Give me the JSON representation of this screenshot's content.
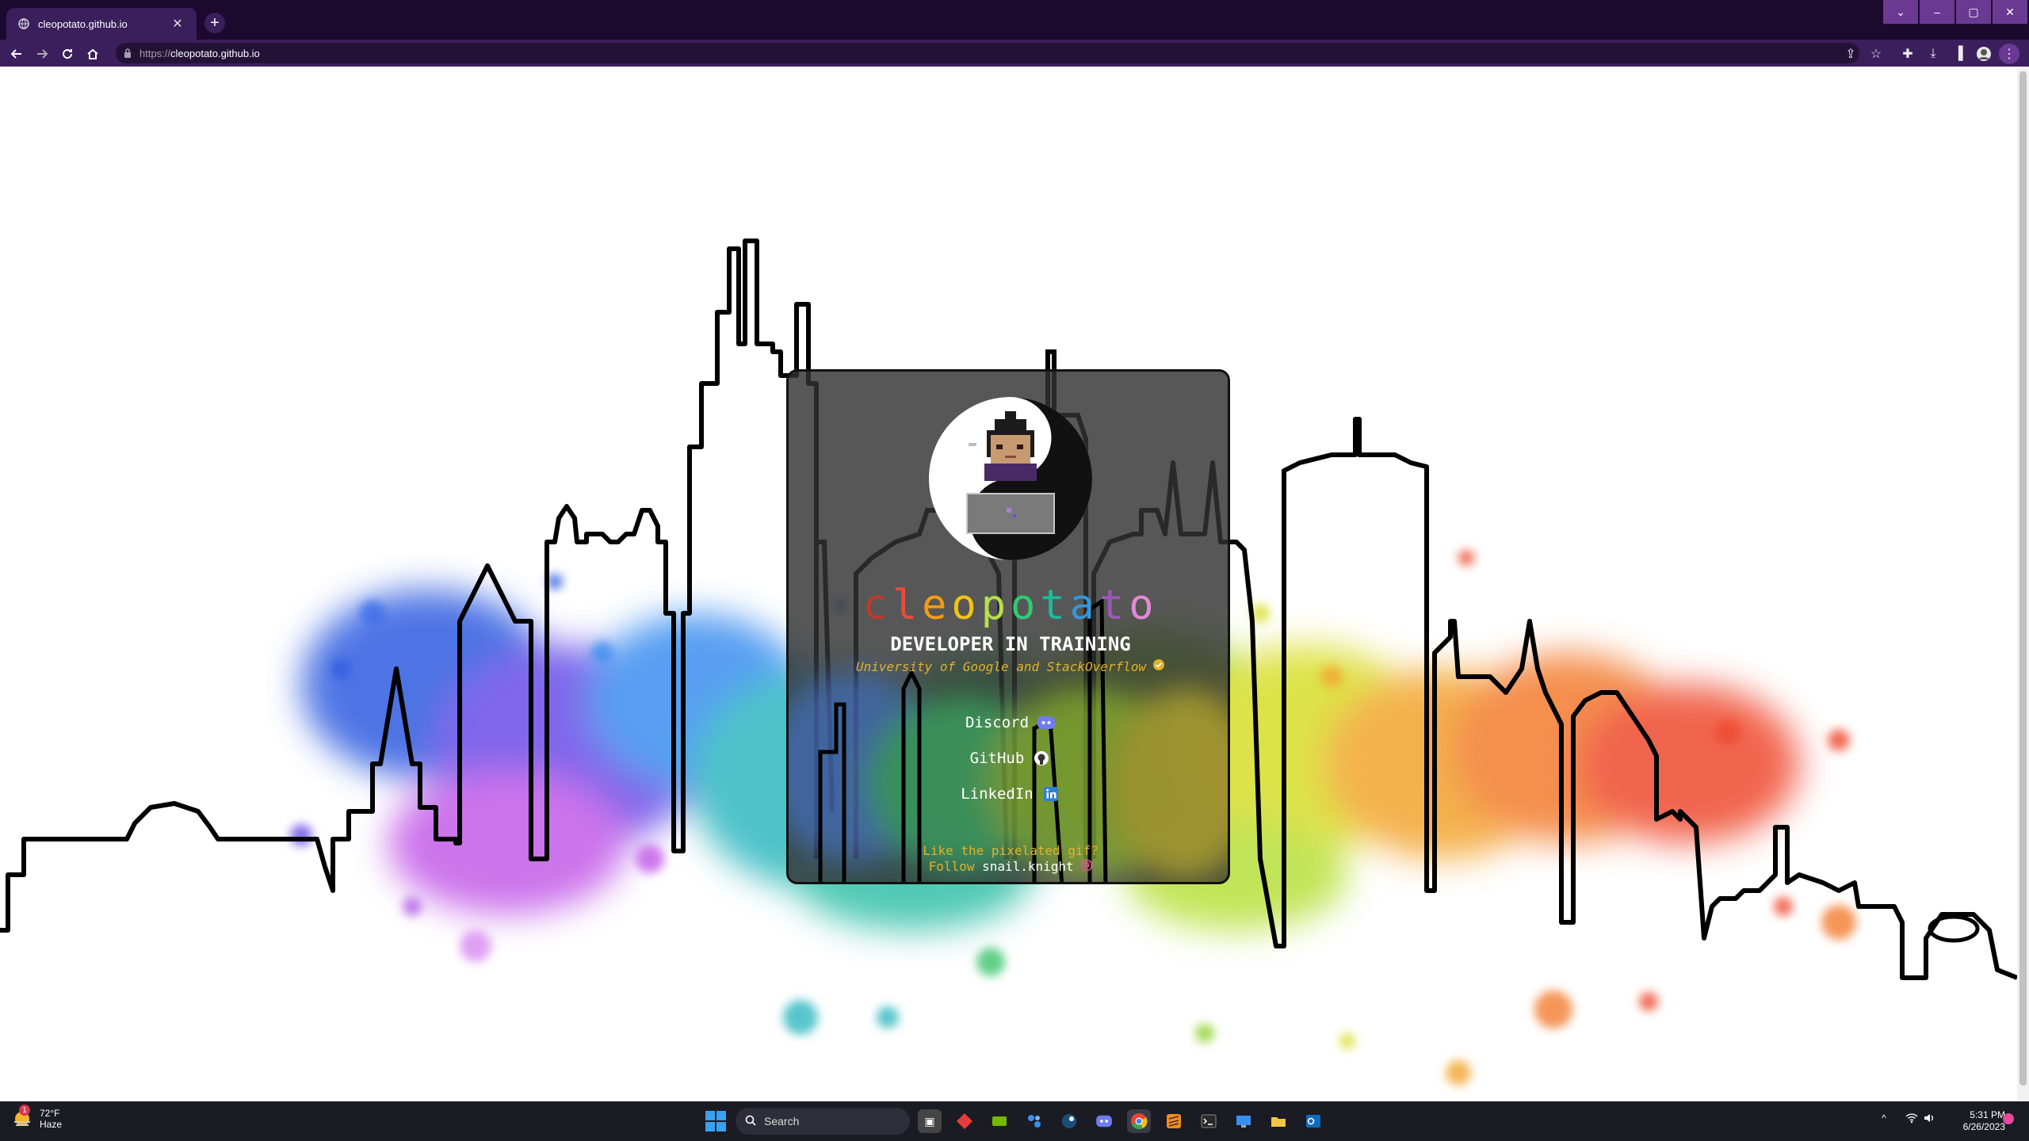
{
  "browser": {
    "tab_title": "cleopotato.github.io",
    "new_tab_label": "+",
    "url_scheme": "https://",
    "url_host": "cleopotato.github.io"
  },
  "card": {
    "name_letters": [
      {
        "ch": "c",
        "color": "#c0392b"
      },
      {
        "ch": "l",
        "color": "#e74c3c"
      },
      {
        "ch": "e",
        "color": "#f39c12"
      },
      {
        "ch": "o",
        "color": "#f1c40f"
      },
      {
        "ch": "p",
        "color": "#b7e04a"
      },
      {
        "ch": "o",
        "color": "#2ecc71"
      },
      {
        "ch": "t",
        "color": "#1abc9c"
      },
      {
        "ch": "a",
        "color": "#3498db"
      },
      {
        "ch": "t",
        "color": "#9b59b6"
      },
      {
        "ch": "o",
        "color": "#e08ad6"
      }
    ],
    "role": "DEVELOPER IN TRAINING",
    "school": "University of Google and StackOverflow",
    "links": [
      {
        "label": "Discord",
        "icon": "discord-icon"
      },
      {
        "label": "GitHub",
        "icon": "github-icon"
      },
      {
        "label": "LinkedIn",
        "icon": "linkedin-icon"
      }
    ],
    "note_line1": "Like the pixelated gif?",
    "note_follow": "Follow",
    "note_handle": "snail.knight",
    "accent_color": "#e3b12b"
  },
  "taskbar": {
    "temperature": "72°F",
    "weather_desc": "Haze",
    "search_placeholder": "Search",
    "time": "5:31 PM",
    "date": "6/26/2023",
    "weather_badge": "1"
  }
}
